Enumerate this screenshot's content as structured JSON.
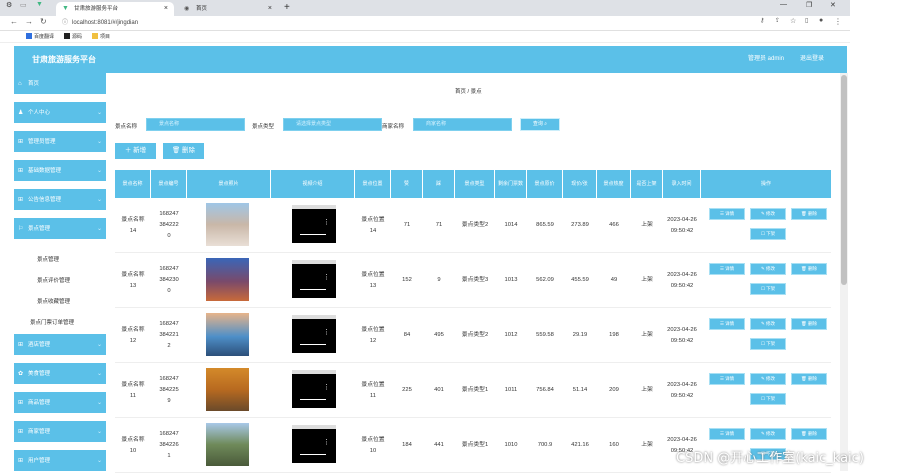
{
  "browser": {
    "active_tab": "甘肃旅游服务平台",
    "inactive_tab": "首页",
    "url": "localhost:8081/#/jingdian",
    "bookmarks": [
      "百度翻译",
      "源码",
      "项目"
    ]
  },
  "header": {
    "app_title": "甘肃旅游服务平台",
    "admin_label": "管理员 admin",
    "logout": "退出登录"
  },
  "sidebar": {
    "menus": [
      {
        "label": "首页"
      },
      {
        "label": "个人中心"
      },
      {
        "label": "管理员管理"
      },
      {
        "label": "基础数据管理"
      },
      {
        "label": "公告信息管理"
      },
      {
        "label": "景点管理"
      }
    ],
    "submenu": [
      "景点管理",
      "景点评价管理",
      "景点收藏管理",
      "景点门票订单管理"
    ],
    "menus_bottom": [
      {
        "label": "酒店管理"
      },
      {
        "label": "美食管理"
      },
      {
        "label": "商品管理"
      },
      {
        "label": "商家管理"
      },
      {
        "label": "用户管理"
      }
    ]
  },
  "breadcrumb": "首页 / 景点",
  "search": {
    "name_label": "景点名称",
    "name_placeholder": "景点名称",
    "type_label": "景点类型",
    "type_placeholder": "请选择景点类型",
    "merchant_label": "商家名称",
    "merchant_placeholder": "商家名称",
    "search_button": "查询"
  },
  "actions": {
    "add": "新增",
    "delete": "删除"
  },
  "table": {
    "headers": [
      "景点名称",
      "景点编号",
      "景点照片",
      "视频介绍",
      "景点位置",
      "赞",
      "踩",
      "景点类型",
      "剩余门票数",
      "景点原价",
      "现价/张",
      "景点热度",
      "是否上架",
      "录入时间",
      "操作"
    ],
    "row_buttons": {
      "detail": "详情",
      "edit": "修改",
      "delete": "删除",
      "offshelf": "下架"
    },
    "rows": [
      {
        "name": "景点名称14",
        "code": "1682473842220",
        "location": "景点位置14",
        "likes": "71",
        "dislikes": "71",
        "type": "景点类型2",
        "tickets": "1014",
        "orig": "865.59",
        "price": "273.89",
        "heat": "466",
        "status": "上架",
        "time": "2023-04-26 09:50:42"
      },
      {
        "name": "景点名称13",
        "code": "1682473842300",
        "location": "景点位置13",
        "likes": "152",
        "dislikes": "9",
        "type": "景点类型3",
        "tickets": "1013",
        "orig": "562.09",
        "price": "455.59",
        "heat": "49",
        "status": "上架",
        "time": "2023-04-26 09:50:42"
      },
      {
        "name": "景点名称12",
        "code": "1682473842212",
        "location": "景点位置12",
        "likes": "84",
        "dislikes": "495",
        "type": "景点类型2",
        "tickets": "1012",
        "orig": "559.58",
        "price": "29.19",
        "heat": "198",
        "status": "上架",
        "time": "2023-04-26 09:50:42"
      },
      {
        "name": "景点名称11",
        "code": "1682473842259",
        "location": "景点位置11",
        "likes": "225",
        "dislikes": "401",
        "type": "景点类型1",
        "tickets": "1011",
        "orig": "756.84",
        "price": "51.14",
        "heat": "209",
        "status": "上架",
        "time": "2023-04-26 09:50:42"
      },
      {
        "name": "景点名称10",
        "code": "1682473842261",
        "location": "景点位置10",
        "likes": "184",
        "dislikes": "441",
        "type": "景点类型1",
        "tickets": "1010",
        "orig": "700.9",
        "price": "421.16",
        "heat": "160",
        "status": "上架",
        "time": "2023-04-26 09:50:42"
      }
    ]
  },
  "watermark": "CSDN @开心工作室(kaic_kaic)"
}
